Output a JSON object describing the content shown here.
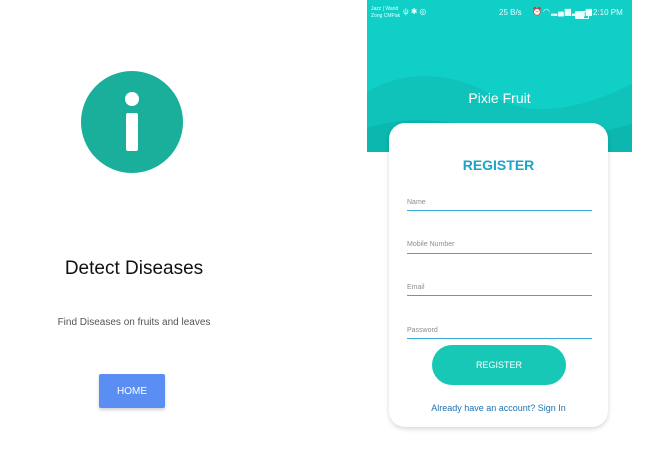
{
  "left": {
    "title": "Detect Diseases",
    "subtitle": "Find Diseases on fruits and leaves",
    "home_label": "HOME",
    "icon": "info-icon"
  },
  "phone": {
    "status_bar": {
      "carrier_1": "Jazz | Warid",
      "carrier_2": "Zong CMPak",
      "net_speed": "25 B/s",
      "time": "2:10 PM"
    },
    "app_title": "Pixie Fruit",
    "form": {
      "title": "REGISTER",
      "fields": [
        {
          "label": "Name"
        },
        {
          "label": "Mobile Number"
        },
        {
          "label": "Email"
        },
        {
          "label": "Password"
        }
      ],
      "register_label": "REGISTER",
      "signin_text": "Already have an account? Sign In"
    }
  },
  "colors": {
    "teal_header": "#10cfc6",
    "info_badge": "#1aaf9a",
    "home_button": "#5a8ef2",
    "register_button": "#18c8b6",
    "form_title": "#1aa4c8",
    "link": "#1e73b0"
  }
}
